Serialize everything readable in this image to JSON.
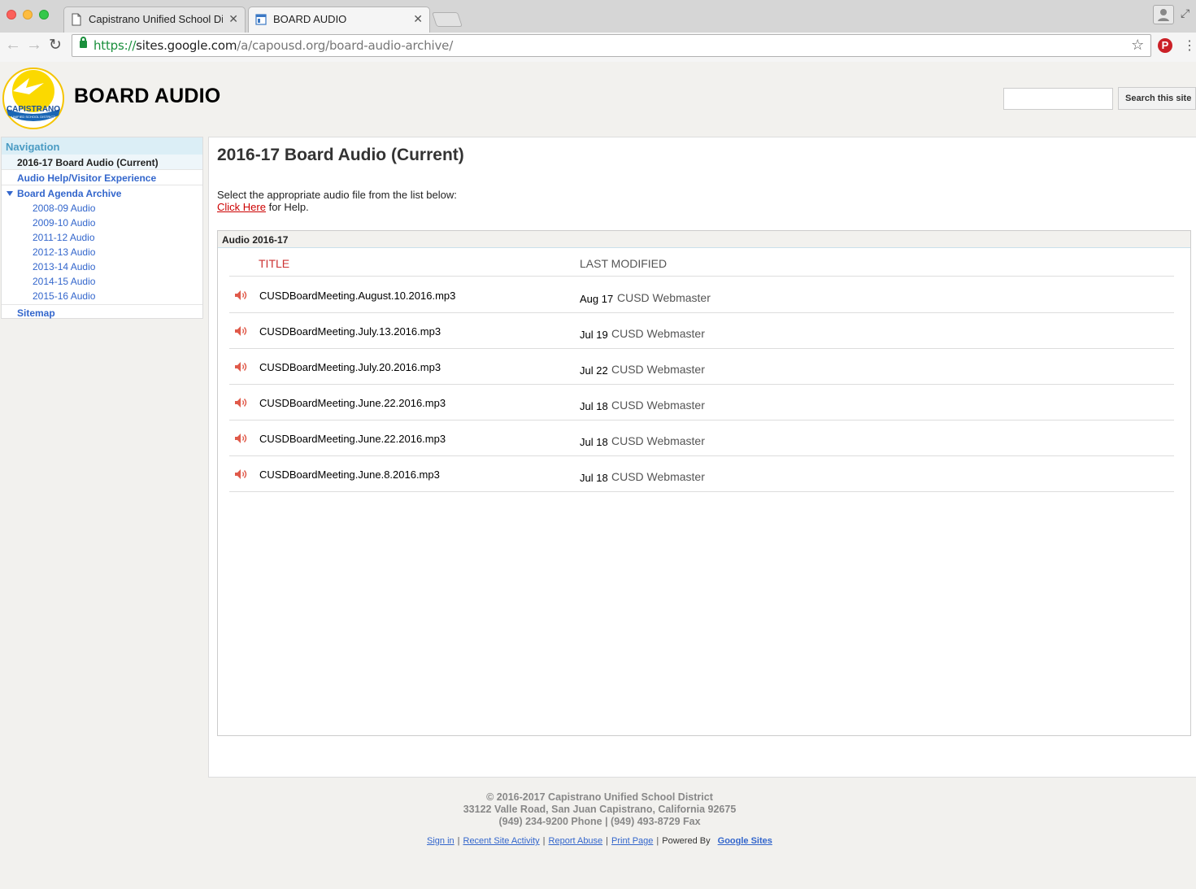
{
  "browser": {
    "tabs": [
      {
        "label": "Capistrano Unified School District"
      },
      {
        "label": "BOARD AUDIO"
      }
    ],
    "url": {
      "scheme": "https://",
      "host": "sites.google.com",
      "path": "/a/capousd.org/board-audio-archive/"
    }
  },
  "site": {
    "logo_text": "CAPISTRANO",
    "logo_subtext": "UNIFIED SCHOOL DISTRICT",
    "title": "BOARD AUDIO",
    "search_button": "Search this site",
    "search_value": ""
  },
  "sidebar": {
    "heading": "Navigation",
    "items": [
      {
        "label": "2016-17 Board Audio (Current)"
      },
      {
        "label": "Audio Help/Visitor Experience"
      },
      {
        "label": "Board Agenda Archive"
      }
    ],
    "archive_items": [
      {
        "label": "2008-09 Audio"
      },
      {
        "label": "2009-10 Audio"
      },
      {
        "label": "2011-12 Audio"
      },
      {
        "label": "2012-13 Audio"
      },
      {
        "label": "2013-14 Audio"
      },
      {
        "label": "2014-15 Audio"
      },
      {
        "label": "2015-16 Audio"
      }
    ],
    "sitemap": "Sitemap"
  },
  "main": {
    "title": "2016-17 Board Audio (Current)",
    "intro": "Select the appropriate audio file from the list below:",
    "help_link": "Click Here",
    "help_suffix": " for Help.",
    "filebox_title": "Audio 2016-17",
    "col_title": "TITLE",
    "col_modified": "LAST MODIFIED",
    "files": [
      {
        "name": "CUSDBoardMeeting.August.10.2016.mp3",
        "date": "Aug 17",
        "user": "CUSD Webmaster"
      },
      {
        "name": "CUSDBoardMeeting.July.13.2016.mp3",
        "date": "Jul 19",
        "user": "CUSD Webmaster"
      },
      {
        "name": "CUSDBoardMeeting.July.20.2016.mp3",
        "date": "Jul 22",
        "user": "CUSD Webmaster"
      },
      {
        "name": "CUSDBoardMeeting.June.22.2016.mp3",
        "date": "Jul 18",
        "user": "CUSD Webmaster"
      },
      {
        "name": "CUSDBoardMeeting.June.22.2016.mp3",
        "date": "Jul 18",
        "user": "CUSD Webmaster"
      },
      {
        "name": "CUSDBoardMeeting.June.8.2016.mp3",
        "date": "Jul 18",
        "user": "CUSD Webmaster"
      }
    ]
  },
  "footer": {
    "copyright": "© 2016-2017 Capistrano Unified School District",
    "address": "33122 Valle Road, San Juan Capistrano, California 92675",
    "phone": "(949) 234-9200 Phone | (949) 493-8729 Fax",
    "links": {
      "sign_in": "Sign in",
      "recent": "Recent Site Activity",
      "report": "Report Abuse",
      "print": "Print Page",
      "powered": "Powered By",
      "google_sites": "Google Sites"
    }
  },
  "colors": {
    "link": "#3366cc",
    "accent_red": "#cc3333",
    "nav_head_bg": "#dbeef6"
  },
  "icons": [
    "document-icon",
    "site-icon",
    "lock-icon",
    "star-icon",
    "pinterest-icon",
    "speaker-icon"
  ]
}
